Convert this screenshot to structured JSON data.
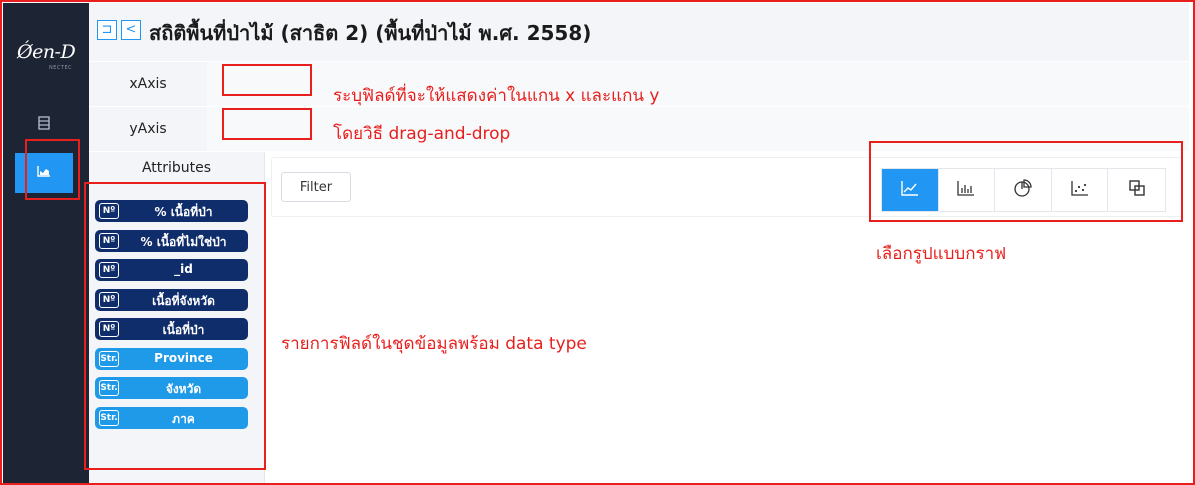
{
  "sidebar": {
    "logo": "Ǿen-D",
    "logo_sub": "NECTEC",
    "nav": [
      {
        "name": "table-view",
        "icon": "table-icon"
      },
      {
        "name": "chart-view",
        "icon": "chart-icon",
        "active": true
      }
    ]
  },
  "header": {
    "title": "สถิติพื้นที่ป่าไม้ (สาธิต 2) (พื้นที่ป่าไม้ พ.ศ. 2558)",
    "back_icon": "back-icon",
    "share_icon": "share-icon"
  },
  "axes": {
    "x_label": "xAxis",
    "y_label": "yAxis"
  },
  "attributes": {
    "title": "Attributes",
    "items": [
      {
        "type": "Nº",
        "name": "% เนื้อที่ป่า",
        "kind": "num"
      },
      {
        "type": "Nº",
        "name": "% เนื้อที่ไม่ใช่ป่า",
        "kind": "num"
      },
      {
        "type": "Nº",
        "name": "_id",
        "kind": "num"
      },
      {
        "type": "Nº",
        "name": "เนื้อที่จังหวัด",
        "kind": "num"
      },
      {
        "type": "Nº",
        "name": "เนื้อที่ป่า",
        "kind": "num"
      },
      {
        "type": "Str.",
        "name": "Province",
        "kind": "str"
      },
      {
        "type": "Str.",
        "name": "จังหวัด",
        "kind": "str"
      },
      {
        "type": "Str.",
        "name": "ภาค",
        "kind": "str"
      }
    ]
  },
  "main": {
    "filter_label": "Filter",
    "chart_types": [
      "line-chart-icon",
      "bar-chart-icon",
      "pie-chart-icon",
      "scatter-chart-icon",
      "other-chart-icon"
    ],
    "active_chart_type": "line-chart-icon"
  },
  "annotations": {
    "axis_note": "ระบุฟิลด์ที่จะให้แสดงค่าในแกน x และแกน y",
    "drag_note": "โดยวิธี drag-and-drop",
    "chart_type_note": "เลือกรูปแบบกราฟ",
    "fields_note": "รายการฟิลด์ในชุดข้อมูลพร้อม data type"
  },
  "colors": {
    "sidebar": "#1d2535",
    "accent": "#2196f3",
    "num_field": "#0f2c6b",
    "str_field": "#1e9ae8",
    "annotation": "#e8201d"
  }
}
